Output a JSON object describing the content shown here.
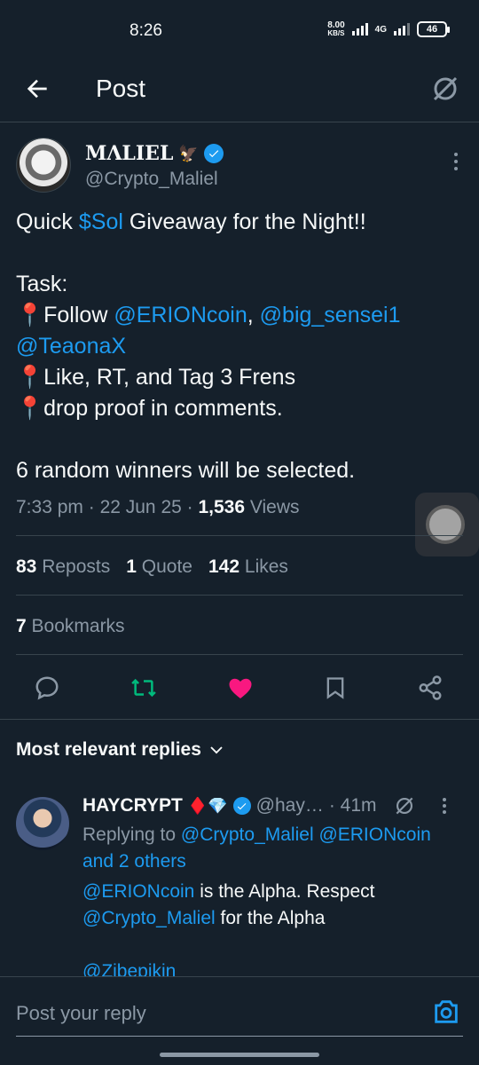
{
  "status_bar": {
    "time": "8:26",
    "speed_value": "8.00",
    "speed_unit": "KB/S",
    "network": "4G",
    "battery": "46"
  },
  "header": {
    "title": "Post"
  },
  "post": {
    "author_name": "MΛLIEL",
    "author_emoji": "🦅",
    "handle": "@Crypto_Maliel",
    "text_parts": [
      {
        "t": "Quick "
      },
      {
        "t": "$Sol",
        "link": true
      },
      {
        "t": " Giveaway for the Night!!\n\nTask:\n📍Follow "
      },
      {
        "t": "@ERIONcoin",
        "link": true
      },
      {
        "t": ", "
      },
      {
        "t": "@big_sensei1",
        "link": true
      },
      {
        "t": "\n"
      },
      {
        "t": "@TeaonaX",
        "link": true
      },
      {
        "t": "\n📍Like, RT, and Tag 3 Frens\n📍drop proof in comments.\n\n6 random winners will be selected."
      }
    ],
    "time": "7:33 pm",
    "date": "22 Jun 25",
    "views_count": "1,536",
    "views_label": "Views",
    "reposts_count": "83",
    "reposts_label": "Reposts",
    "quotes_count": "1",
    "quotes_label": "Quote",
    "likes_count": "142",
    "likes_label": "Likes",
    "bookmarks_count": "7",
    "bookmarks_label": "Bookmarks"
  },
  "replies": {
    "sort_label": "Most relevant replies",
    "first": {
      "name": "HAYCRYPT",
      "name_emoji": "♦️💎",
      "handle": "@hay…",
      "age": "· 41m",
      "replying_prefix": "Replying to ",
      "replying_to": "@Crypto_Maliel @ERIONcoin",
      "replying_suffix": "and 2 others",
      "body_mention1": "@ERIONcoin",
      "body_text1": " is the Alpha. Respect",
      "body_mention2": "@Crypto_Maliel",
      "body_text2": " for the Alpha",
      "body_mention3": "@Zibepikin"
    }
  },
  "compose": {
    "placeholder": "Post your reply"
  },
  "colors": {
    "background": "#15202b",
    "accent": "#1d9bf0",
    "repost": "#00ba7c",
    "like": "#f91880",
    "muted": "#8b98a5"
  }
}
